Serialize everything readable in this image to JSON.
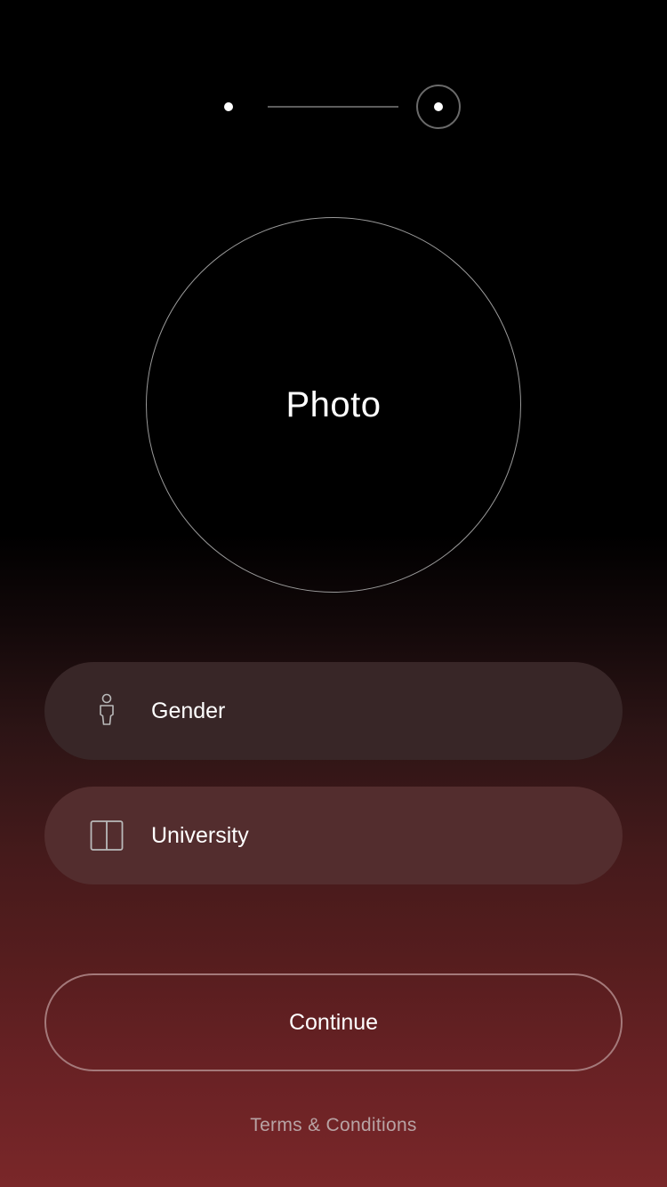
{
  "stepper": {
    "current_step": 2,
    "total_steps": 2
  },
  "photo": {
    "label": "Photo"
  },
  "fields": {
    "gender": {
      "label": "Gender",
      "icon": "person-icon"
    },
    "university": {
      "label": "University",
      "icon": "book-icon"
    }
  },
  "actions": {
    "continue_label": "Continue",
    "terms_label": "Terms & Conditions"
  },
  "colors": {
    "background_top": "#000000",
    "background_bottom": "#7a2729",
    "field_gender_bg": "#382627",
    "field_university_bg": "#532d2e",
    "terms_text": "#b8a3a4"
  }
}
